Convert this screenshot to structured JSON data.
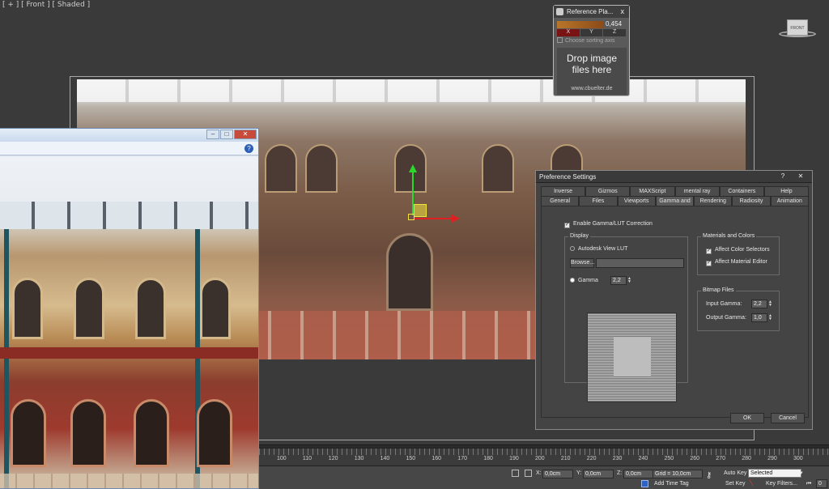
{
  "viewport": {
    "label": "[ + ] [ Front ] [ Shaded ]"
  },
  "reference_panel": {
    "title": "Reference Pla...",
    "close": "x",
    "value": "0,454",
    "axes": [
      "X",
      "Y",
      "Z"
    ],
    "sort_label": "Choose sorting axis",
    "drop_line1": "Drop image",
    "drop_line2": "files here",
    "url": "www.cbuelter.de"
  },
  "image_window": {
    "buttons": [
      "–",
      "□",
      "✕"
    ],
    "help": "?"
  },
  "dialog": {
    "title": "Preference Settings",
    "btn_help": "?",
    "btn_close": "✕",
    "tabs_row1": [
      "Inverse Kinematics",
      "Gizmos",
      "MAXScript",
      "mental ray",
      "Containers",
      "Help"
    ],
    "tabs_row2": [
      "General",
      "Files",
      "Viewports",
      "Gamma and LUT",
      "Rendering",
      "Radiosity",
      "Animation"
    ],
    "enable_label": "Enable Gamma/LUT Correction",
    "display_group": "Display",
    "autodesk_lut": "Autodesk View LUT",
    "browse": "Browse...",
    "gamma_label": "Gamma",
    "gamma_value": "2,2",
    "materials_group": "Materials and Colors",
    "affect_color": "Affect Color Selectors",
    "affect_material": "Affect Material Editor",
    "bitmap_group": "Bitmap Files",
    "input_gamma_label": "Input Gamma:",
    "input_gamma_value": "2,2",
    "output_gamma_label": "Output Gamma:",
    "output_gamma_value": "1,0",
    "ok": "OK",
    "cancel": "Cancel"
  },
  "timeline": {
    "ticks": [
      "100",
      "110",
      "120",
      "130",
      "140",
      "150",
      "160",
      "170",
      "180",
      "190",
      "200",
      "210",
      "220",
      "230",
      "240",
      "250",
      "260",
      "270",
      "280",
      "290",
      "300"
    ]
  },
  "statusbar": {
    "x_label": "X:",
    "x_value": "0,0cm",
    "y_label": "Y:",
    "y_value": "0,0cm",
    "z_label": "Z:",
    "z_value": "0,0cm",
    "grid": "Grid = 10,0cm",
    "auto_key": "Auto Key",
    "selected": "Selected",
    "set_key": "Set Key",
    "key_filters": "Key Filters...",
    "add_time_tag": "Add Time Tag",
    "frame_value": "0"
  }
}
